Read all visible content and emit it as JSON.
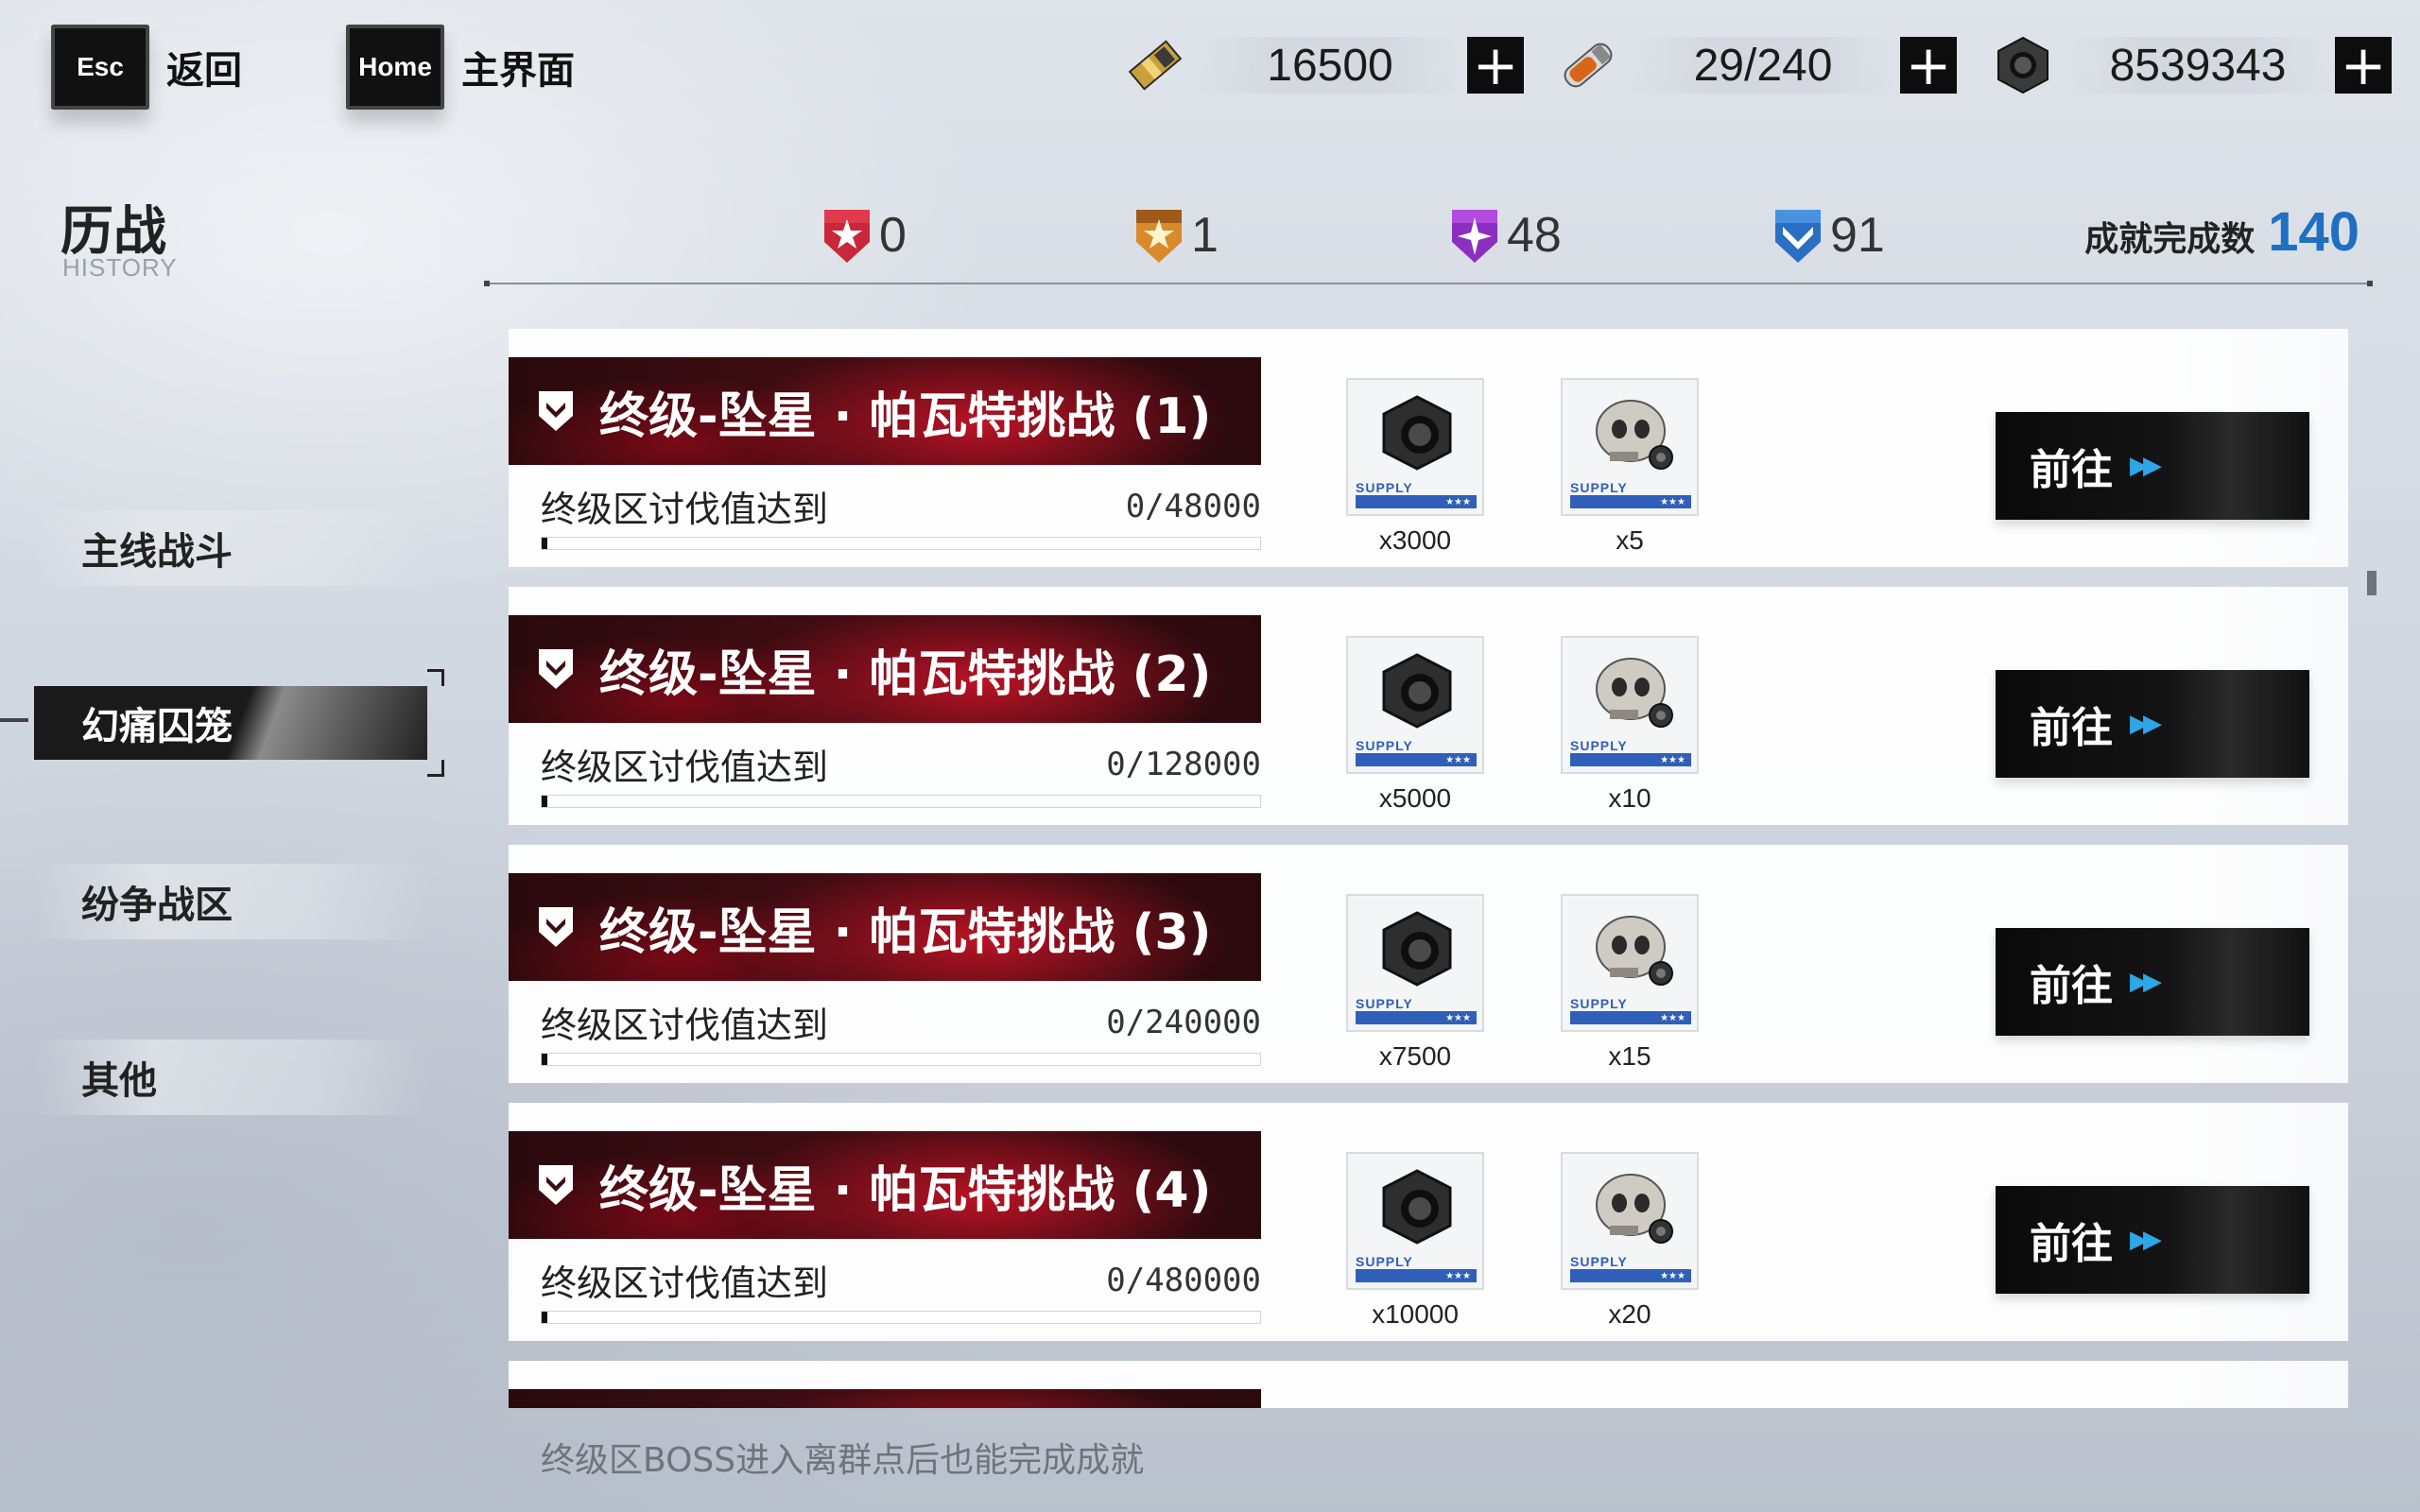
{
  "topbar": {
    "esc_key": "Esc",
    "esc_label": "返回",
    "home_key": "Home",
    "home_label": "主界面",
    "resources": [
      {
        "icon": "gold-ticket-icon",
        "value": "16500"
      },
      {
        "icon": "energy-vial-icon",
        "value": "29/240"
      },
      {
        "icon": "hex-nut-icon",
        "value": "8539343"
      }
    ],
    "plus": "+"
  },
  "header": {
    "title": "历战",
    "subtitle": "HISTORY",
    "medals": [
      {
        "icon": "red-medal-icon",
        "color": "#c8283a",
        "count": "0"
      },
      {
        "icon": "gold-medal-icon",
        "color": "#d98a2a",
        "count": "1"
      },
      {
        "icon": "purple-medal-icon",
        "color": "#8a2fc0",
        "count": "48"
      },
      {
        "icon": "blue-medal-icon",
        "color": "#2a6fc4",
        "count": "91"
      }
    ],
    "achievement_label": "成就完成数",
    "achievement_count": "140"
  },
  "sidebar": {
    "items": [
      {
        "label": "主线战斗",
        "active": false
      },
      {
        "label": "幻痛囚笼",
        "active": true
      },
      {
        "label": "纷争战区",
        "active": false
      },
      {
        "label": "其他",
        "active": false
      }
    ]
  },
  "achievements": [
    {
      "title": "终级-坠星 · 帕瓦特挑战 (1)",
      "desc": "终级区讨伐值达到",
      "progress": "0/48000",
      "fraction": 0.0,
      "rewards": [
        {
          "icon": "hex-nut-icon",
          "qty": "x3000"
        },
        {
          "icon": "skull-part-icon",
          "qty": "x5"
        }
      ],
      "button": "前往"
    },
    {
      "title": "终级-坠星 · 帕瓦特挑战 (2)",
      "desc": "终级区讨伐值达到",
      "progress": "0/128000",
      "fraction": 0.0,
      "rewards": [
        {
          "icon": "hex-nut-icon",
          "qty": "x5000"
        },
        {
          "icon": "skull-part-icon",
          "qty": "x10"
        }
      ],
      "button": "前往"
    },
    {
      "title": "终级-坠星 · 帕瓦特挑战 (3)",
      "desc": "终级区讨伐值达到",
      "progress": "0/240000",
      "fraction": 0.0,
      "rewards": [
        {
          "icon": "hex-nut-icon",
          "qty": "x7500"
        },
        {
          "icon": "skull-part-icon",
          "qty": "x15"
        }
      ],
      "button": "前往"
    },
    {
      "title": "终级-坠星 · 帕瓦特挑战 (4)",
      "desc": "终级区讨伐值达到",
      "progress": "0/480000",
      "fraction": 0.0,
      "rewards": [
        {
          "icon": "hex-nut-icon",
          "qty": "x10000"
        },
        {
          "icon": "skull-part-icon",
          "qty": "x20"
        }
      ],
      "button": "前往"
    }
  ],
  "reward_tag": {
    "word": "SUPPLY",
    "stars": "★★★"
  },
  "footer_tip": "终级区BOSS进入离群点后也能完成成就",
  "colors": {
    "accent_blue": "#1f6fc4",
    "arrow_blue": "#2ea6e8",
    "title_red": "#3d0c12"
  }
}
